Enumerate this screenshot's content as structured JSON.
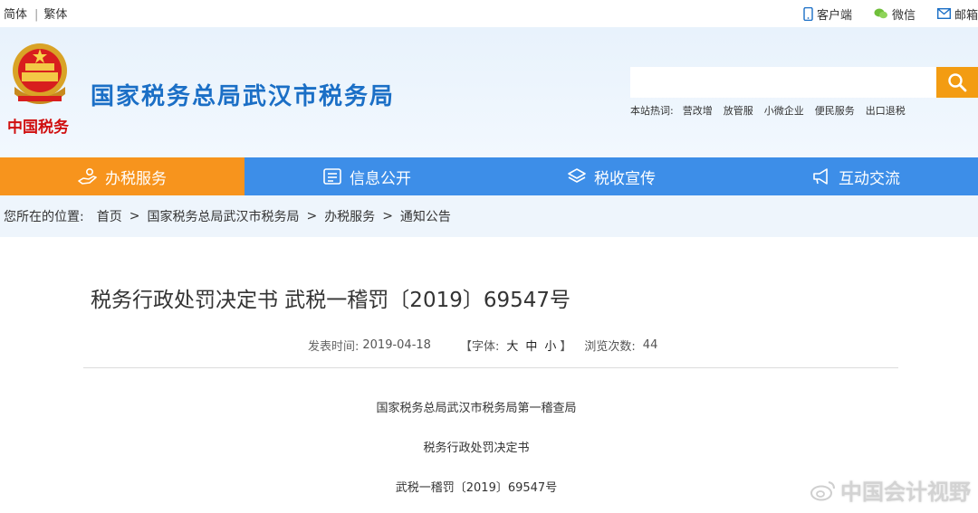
{
  "topbar": {
    "lang_simplified": "简体",
    "lang_separator": "|",
    "lang_traditional": "繁体",
    "quick_links": [
      {
        "icon": "phone-icon",
        "label": "客户端"
      },
      {
        "icon": "wechat-icon",
        "label": "微信"
      },
      {
        "icon": "mail-icon",
        "label": "邮箱"
      }
    ]
  },
  "header": {
    "brand_script": "中国税务",
    "site_title": "国家税务总局武汉市税务局",
    "search": {
      "value": "",
      "placeholder": ""
    },
    "hotwords_label": "本站热词:",
    "hotwords": [
      "营改增",
      "放管服",
      "小微企业",
      "便民服务",
      "出口退税"
    ]
  },
  "nav": {
    "items": [
      {
        "label": "办税服务",
        "icon": "hand-service-icon",
        "active": true
      },
      {
        "label": "信息公开",
        "icon": "document-icon",
        "active": false
      },
      {
        "label": "税收宣传",
        "icon": "layers-icon",
        "active": false
      },
      {
        "label": "互动交流",
        "icon": "megaphone-icon",
        "active": false
      }
    ]
  },
  "breadcrumb": {
    "label": "您所在的位置:",
    "items": [
      "首页",
      "国家税务总局武汉市税务局",
      "办税服务",
      "通知公告"
    ],
    "separator": ">"
  },
  "article": {
    "title": "税务行政处罚决定书 武税一稽罚〔2019〕69547号",
    "publish_label": "发表时间:",
    "publish_date": "2019-04-18",
    "font_label": "【字体:",
    "font_sizes": [
      "大",
      "中",
      "小"
    ],
    "font_close": "】",
    "views_label": "浏览次数:",
    "views": "44",
    "body_lines": [
      "国家税务总局武汉市税务局第一稽查局",
      "税务行政处罚决定书",
      "武税一稽罚〔2019〕69547号"
    ]
  },
  "watermark": {
    "text": "中国会计视野",
    "icon": "weibo-icon"
  },
  "colors": {
    "nav_blue": "#3d8ee8",
    "nav_active_orange": "#f7941d",
    "title_blue": "#1b6fc6",
    "search_orange": "#f39c12"
  }
}
